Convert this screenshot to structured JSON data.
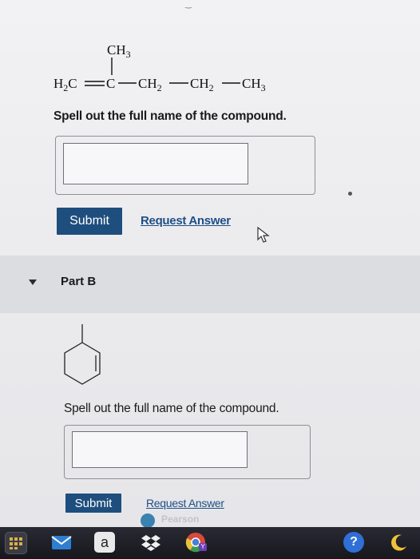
{
  "part_a": {
    "structure": {
      "branch": "CH3",
      "chain": [
        "H2C",
        "C",
        "CH2",
        "CH2",
        "CH3"
      ]
    },
    "prompt": "Spell out the full name of the compound.",
    "answer_value": "",
    "submit_label": "Submit",
    "request_answer_label": "Request Answer"
  },
  "part_b": {
    "header_label": "Part B",
    "prompt": "Spell out the full name of the compound.",
    "answer_value": "",
    "submit_label": "Submit",
    "request_answer_label": "Request Answer",
    "overlapping_logo_text": "Pearson"
  },
  "dock": {
    "items": [
      {
        "icon": "launchpad-icon"
      },
      {
        "icon": "mail-icon"
      },
      {
        "icon": "amazon-icon",
        "label": "a"
      },
      {
        "icon": "dropbox-icon"
      },
      {
        "icon": "chrome-icon",
        "label": "Y"
      },
      {
        "icon": "help-icon",
        "label": "?"
      },
      {
        "icon": "moon-icon"
      }
    ]
  }
}
